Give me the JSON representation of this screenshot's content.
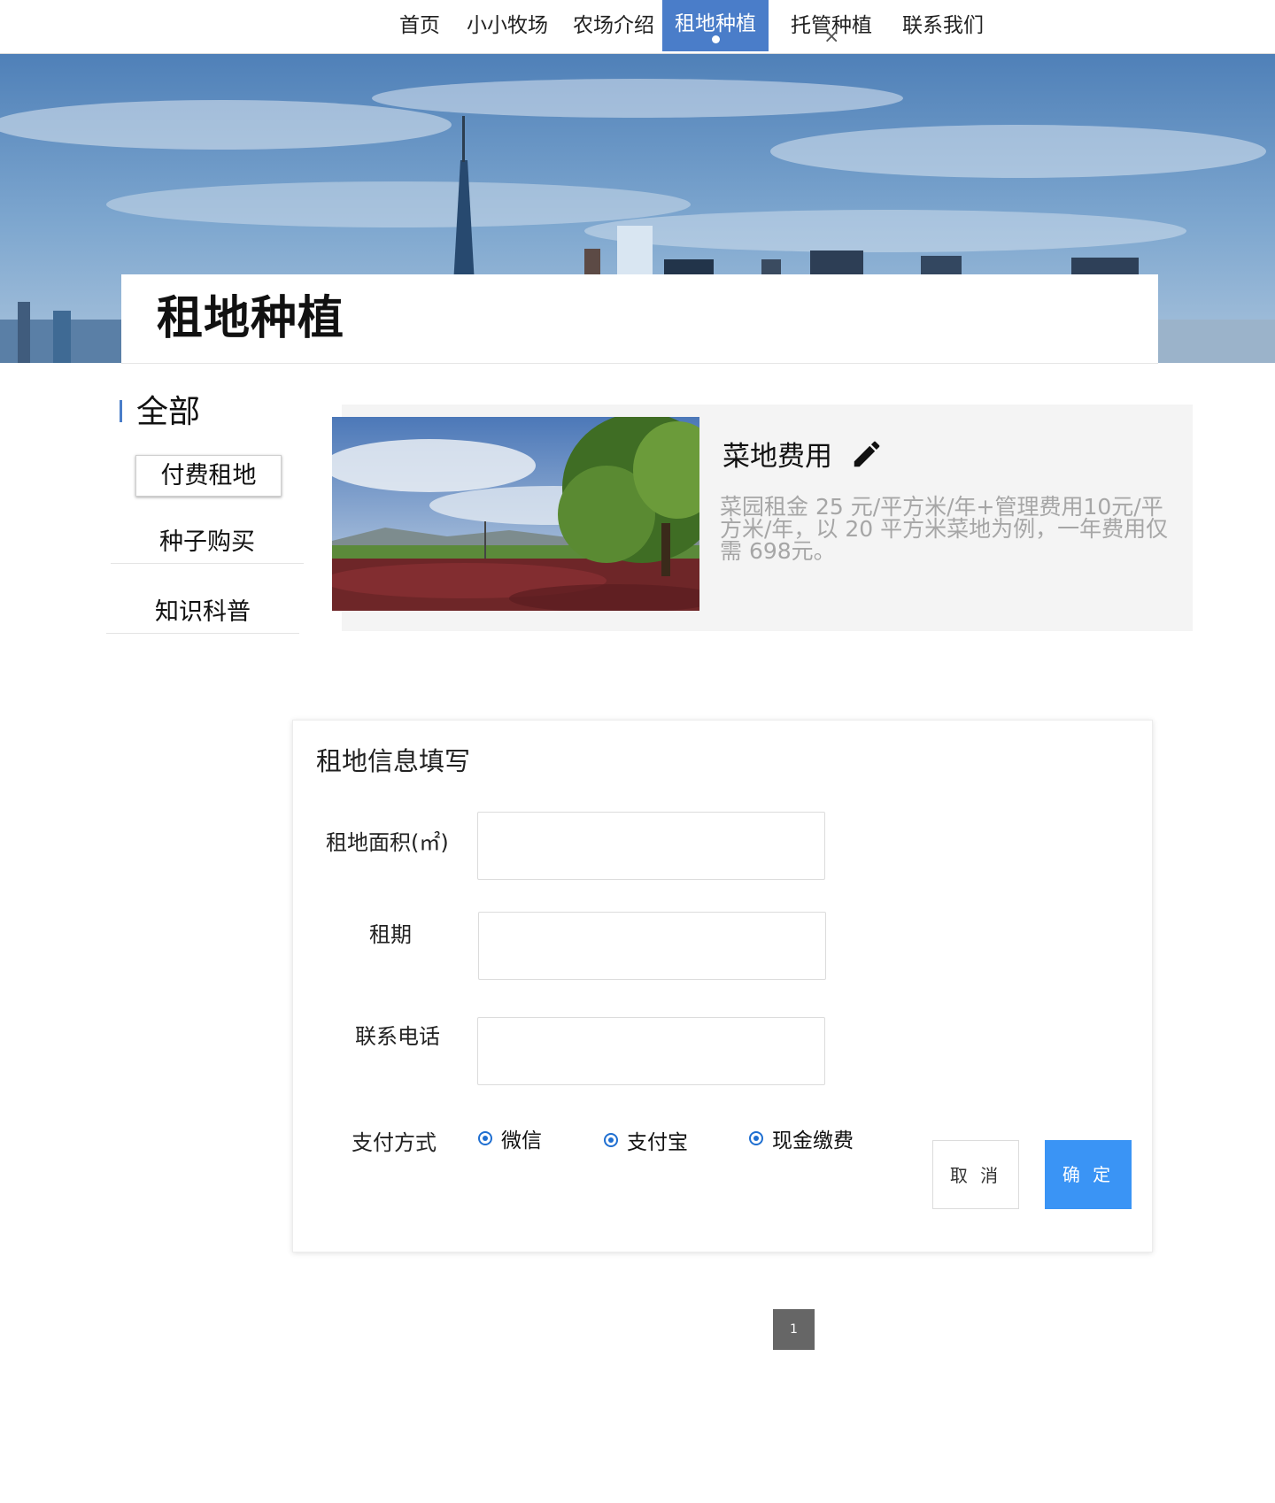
{
  "nav": {
    "items": [
      {
        "label": "首页"
      },
      {
        "label": "小小牧场"
      },
      {
        "label": "农场介绍"
      },
      {
        "label": "租地种植"
      },
      {
        "label": "托管种植"
      },
      {
        "label": "联系我们"
      }
    ],
    "active_index": 3,
    "close_glyph": "×",
    "accent_color": "#4a7dc9"
  },
  "banner": {
    "title": "租地种植"
  },
  "sidebar": {
    "heading": "全部",
    "items": [
      {
        "label": "付费租地",
        "active": true
      },
      {
        "label": "种子购买",
        "active": false
      },
      {
        "label": "知识科普",
        "active": false
      }
    ]
  },
  "card": {
    "title": "菜地费用",
    "icon": "pencil-icon",
    "description": "菜园租金 25 元/平方米/年+管理费用10元/平方米/年，以 20 平方米菜地为例，一年费用仅需 698元。"
  },
  "form": {
    "title": "租地信息填写",
    "area_label": "租地面积(㎡)",
    "area_value": "",
    "term_label": "租期",
    "term_value": "",
    "phone_label": "联系电话",
    "phone_value": "",
    "payment_label": "支付方式",
    "payment_options": [
      {
        "label": "微信"
      },
      {
        "label": "支付宝"
      },
      {
        "label": "现金缴费"
      }
    ],
    "cancel_label": "取 消",
    "ok_label": "确 定",
    "ok_color": "#3a94f5"
  },
  "pager": {
    "current_page": "1"
  }
}
